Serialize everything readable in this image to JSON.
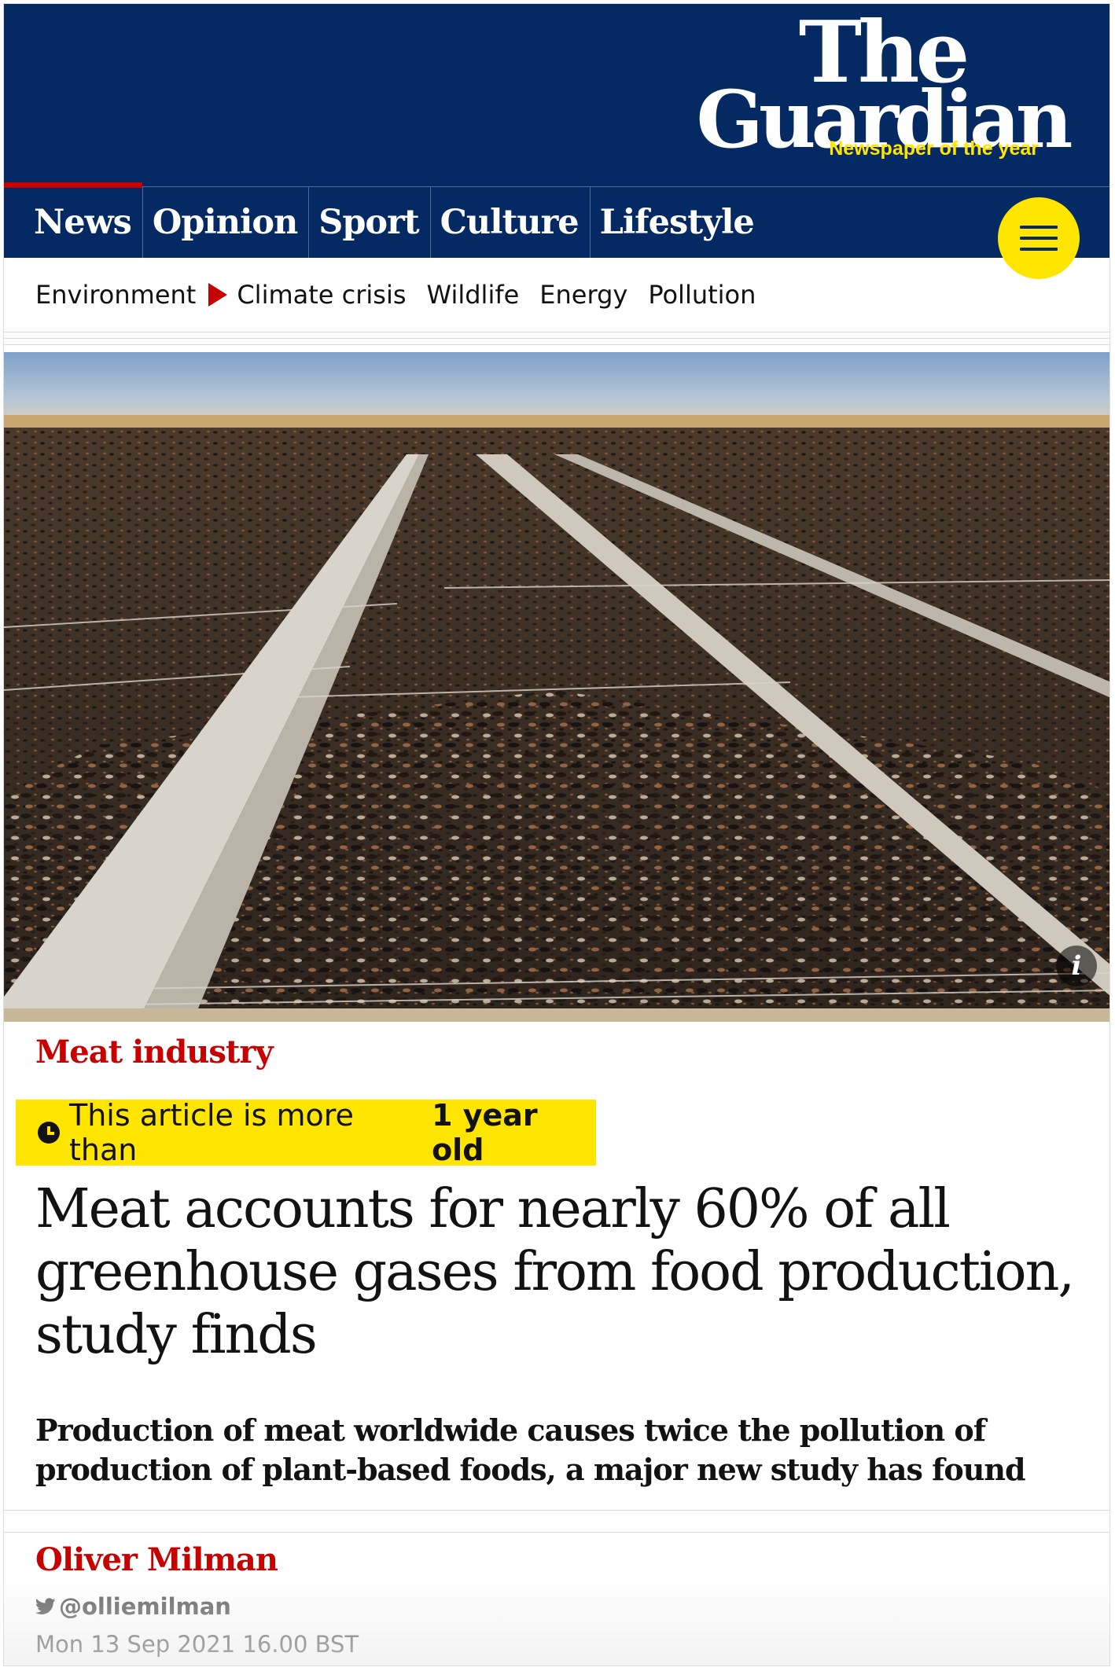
{
  "masthead": {
    "logo_the": "The",
    "logo_guardian": "Guardian",
    "tagline": "Newspaper of the year",
    "brand_color": "#052962",
    "accent_color": "#ffe500"
  },
  "pillars": [
    {
      "label": "News",
      "active": true
    },
    {
      "label": "Opinion"
    },
    {
      "label": "Sport"
    },
    {
      "label": "Culture"
    },
    {
      "label": "Lifestyle"
    }
  ],
  "menu_icon": "hamburger-icon",
  "subnav": {
    "section": "Environment",
    "current": "Climate crisis",
    "links": [
      "Wildlife",
      "Energy",
      "Pollution"
    ]
  },
  "hero": {
    "info_label": "i"
  },
  "article": {
    "kicker": "Meat industry",
    "age_notice_pre": "This article is more than",
    "age_notice_bold": "1 year old",
    "headline": "Meat accounts for nearly 60% of all greenhouse gases from food production, study finds",
    "standfirst": "Production of meat worldwide causes twice the pollution of production of plant-based foods, a major new study has found",
    "author": "Oliver Milman",
    "twitter": "@olliemilman",
    "date": "Mon 13 Sep 2021 16.00 BST",
    "kicker_color": "#c70000"
  }
}
